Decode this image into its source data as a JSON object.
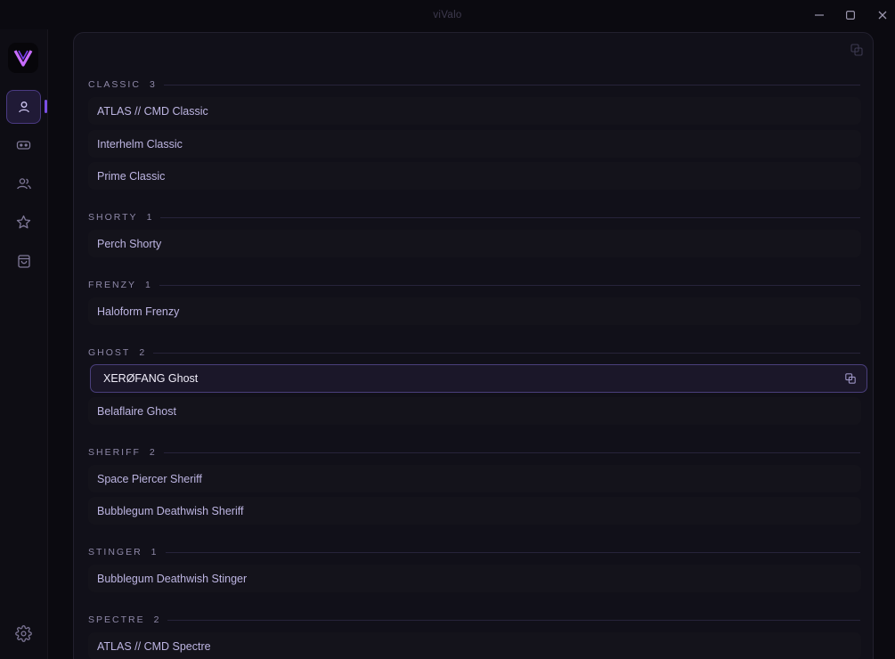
{
  "window": {
    "title": "viValo"
  },
  "sidebar": {
    "logo_letter": "V",
    "items": [
      {
        "name": "profile",
        "icon": "user-icon",
        "active": true
      },
      {
        "name": "games",
        "icon": "gamepad-icon",
        "active": false
      },
      {
        "name": "friends",
        "icon": "users-icon",
        "active": false
      },
      {
        "name": "favorites",
        "icon": "star-icon",
        "active": false
      },
      {
        "name": "store",
        "icon": "shopping-bag-icon",
        "active": false
      }
    ],
    "settings_icon": "gear-icon"
  },
  "sections": [
    {
      "label": "CLASSIC",
      "count": "3",
      "items": [
        "ATLAS // CMD Classic",
        "Interhelm Classic",
        "Prime Classic"
      ]
    },
    {
      "label": "SHORTY",
      "count": "1",
      "items": [
        "Perch Shorty"
      ]
    },
    {
      "label": "FRENZY",
      "count": "1",
      "items": [
        "Haloform Frenzy"
      ]
    },
    {
      "label": "GHOST",
      "count": "2",
      "items": [
        "XERØFANG Ghost",
        "Belaflaire Ghost"
      ]
    },
    {
      "label": "SHERIFF",
      "count": "2",
      "items": [
        "Space Piercer Sheriff",
        "Bubblegum Deathwish Sheriff"
      ]
    },
    {
      "label": "STINGER",
      "count": "1",
      "items": [
        "Bubblegum Deathwish Stinger"
      ]
    },
    {
      "label": "SPECTRE",
      "count": "2",
      "items": [
        "ATLAS // CMD Spectre"
      ]
    }
  ],
  "selected_item": "XERØFANG Ghost",
  "colors": {
    "accent": "#7b4fe6",
    "background": "#0b0a10",
    "panel": "#111019"
  }
}
